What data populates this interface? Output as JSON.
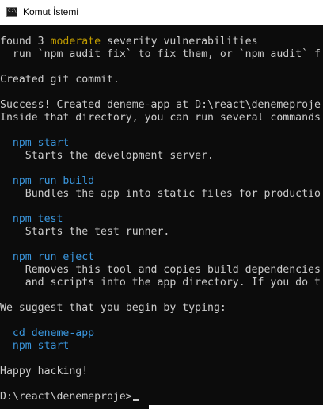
{
  "window": {
    "title": "Komut İstemi",
    "icon_text": "C:\\",
    "icon": "command-prompt-icon"
  },
  "colors": {
    "background": "#0c0c0c",
    "text": "#cccccc",
    "command": "#3a96dd",
    "warning": "#c19c00"
  },
  "console": {
    "audit_pre": "found 3 ",
    "audit_level": "moderate",
    "audit_post": " severity vulnerabilities",
    "audit_fix": "  run `npm audit fix` to fix them, or `npm audit` f",
    "git_commit": "Created git commit.",
    "success": "Success! Created deneme-app at D:\\react\\denemeproje",
    "inside": "Inside that directory, you can run several commands",
    "cmd_start": "npm start",
    "desc_start": "Starts the development server.",
    "cmd_build": "npm run build",
    "desc_build": "Bundles the app into static files for productio",
    "cmd_test": "npm test",
    "desc_test": "Starts the test runner.",
    "cmd_eject": "npm run eject",
    "desc_eject_1": "Removes this tool and copies build dependencies",
    "desc_eject_2": "and scripts into the app directory. If you do t",
    "suggest": "We suggest that you begin by typing:",
    "cd_cmd": "cd deneme-app",
    "start_cmd": "npm start",
    "happy": "Happy hacking!",
    "prompt": "D:\\react\\denemeproje>"
  }
}
